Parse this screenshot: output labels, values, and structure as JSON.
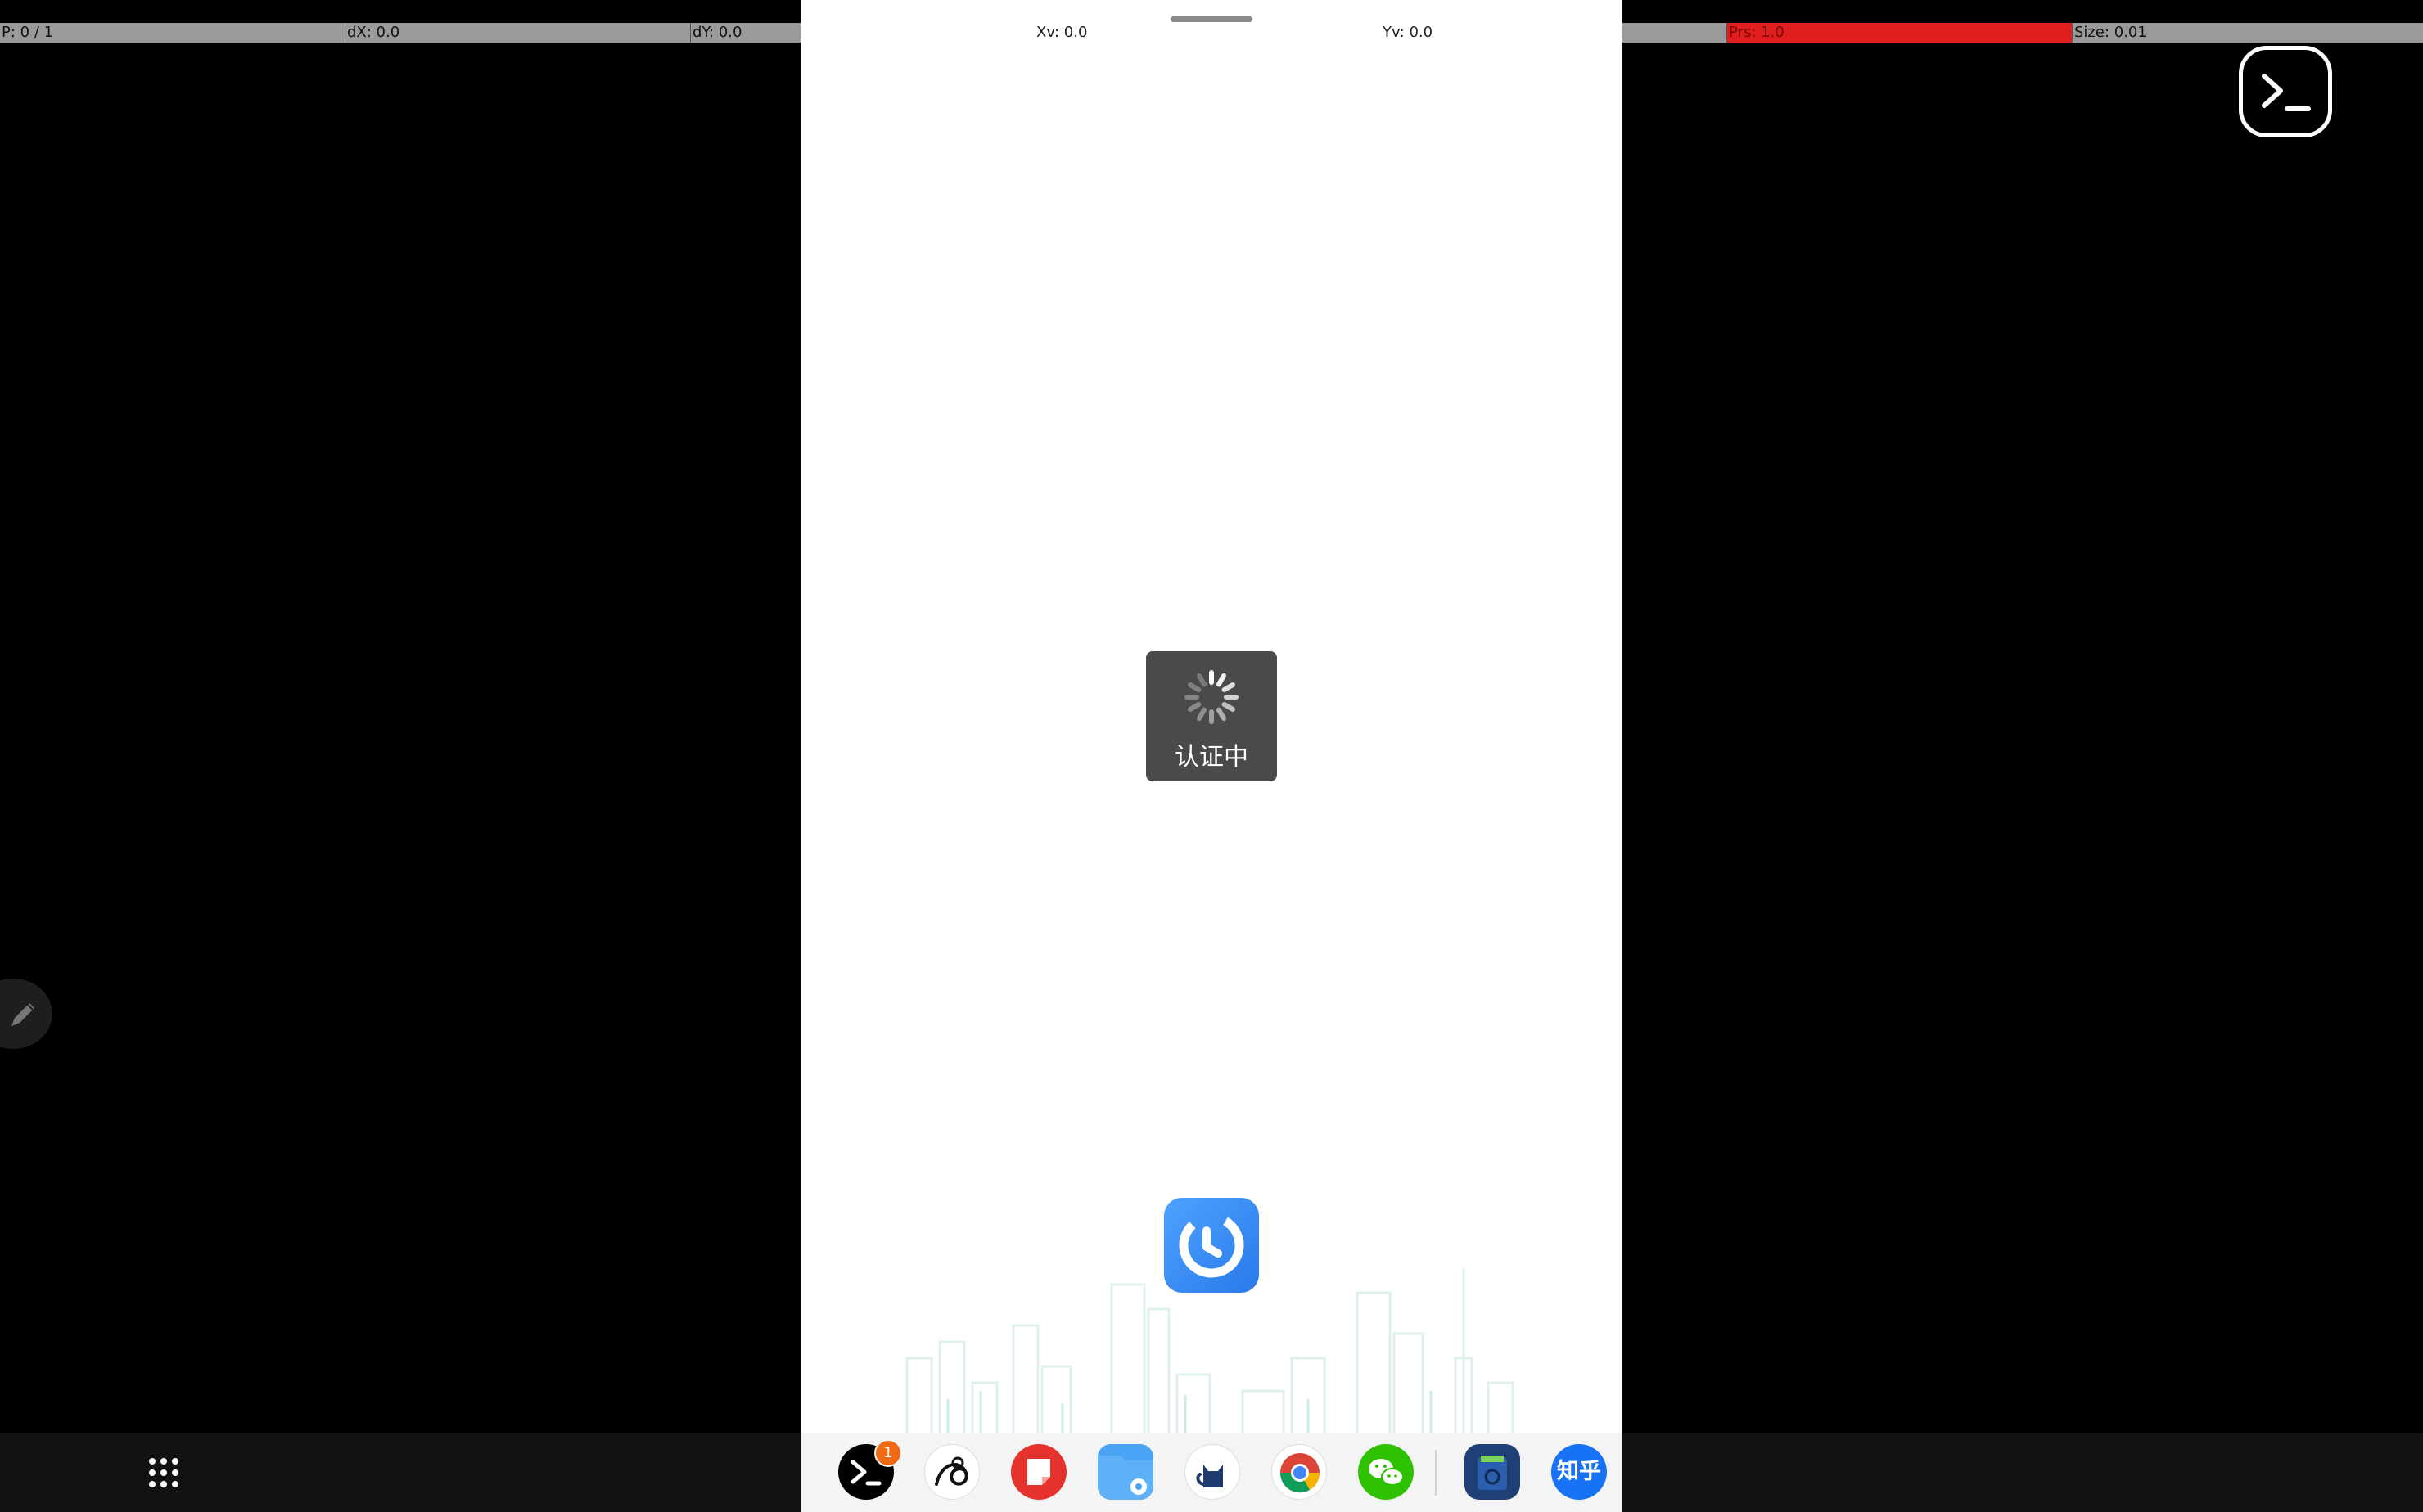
{
  "pointer_bar": {
    "p": "P: 0 / 1",
    "dx": "dX: 0.0",
    "dy": "dY: 0.0",
    "xv": "Xv: 0.0",
    "yv": "Yv: 0.0",
    "prs": "Prs: 1.0",
    "size": "Size: 0.01"
  },
  "loading_dialog": {
    "text": "认证中"
  },
  "dock": {
    "apps": [
      {
        "name": "Terminal",
        "color": "#000000",
        "badge": "1"
      },
      {
        "name": "Drawing app",
        "color": "#ffffff"
      },
      {
        "name": "Notes",
        "color": "#e5322d"
      },
      {
        "name": "Files",
        "color": "#4aa3f5"
      },
      {
        "name": "Cat app",
        "color": "#ffffff"
      },
      {
        "name": "Chrome",
        "color": "#ffffff"
      },
      {
        "name": "WeChat",
        "color": "#2dc100"
      },
      {
        "name": "Camera/Scanner",
        "color": "#1f3f77"
      },
      {
        "name": "Zhihu",
        "color": "#1772f6",
        "label": "知乎"
      }
    ]
  },
  "icons": {
    "top_right": "terminal-icon",
    "left_edge": "pencil-icon",
    "taskbar_left": "app-grid-icon"
  },
  "colors": {
    "pressure_bar": "#e01e1e",
    "debug_bar": "#9a9a9a",
    "accent": "#2a79ea"
  }
}
